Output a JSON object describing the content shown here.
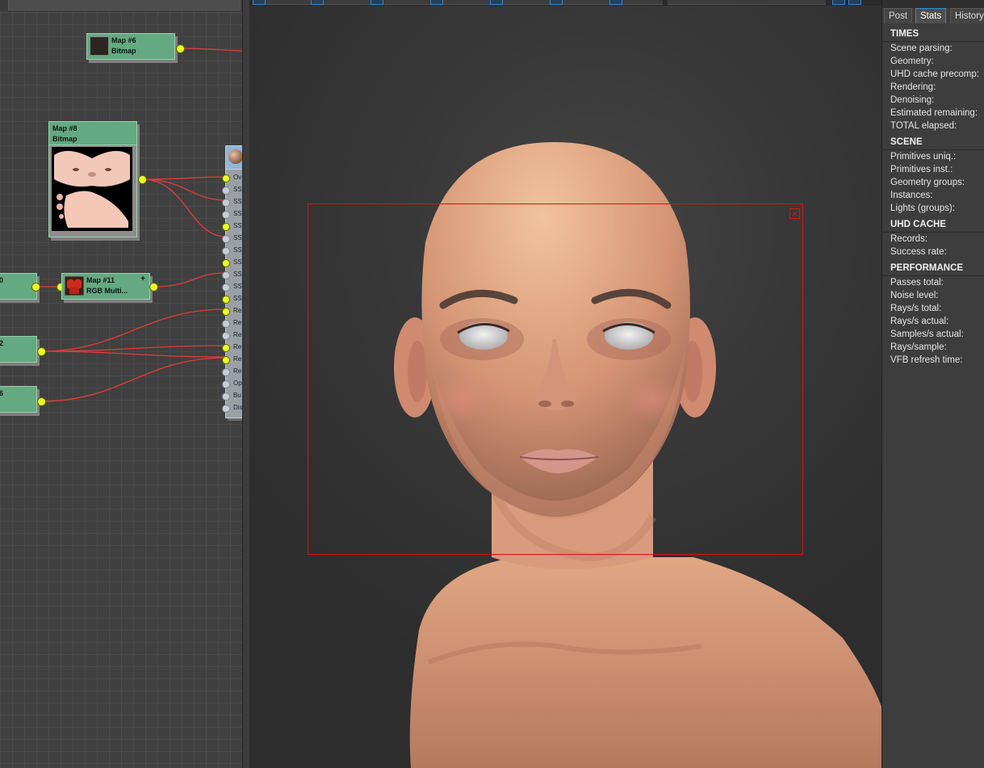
{
  "slate": {
    "nodes": {
      "map6": {
        "title": "Map #6",
        "type": "Bitmap"
      },
      "map8": {
        "title": "Map #8",
        "type": "Bitmap"
      },
      "map11": {
        "title": "Map #11",
        "type": "RGB  Multi...",
        "plus": "+"
      },
      "left_a": "0",
      "left_b": "2",
      "left_c": "6"
    },
    "material_slots": [
      "Ov",
      "SS",
      "SS",
      "SS",
      "SS",
      "SS",
      "SS",
      "SS",
      "SS",
      "SS",
      "SS",
      "Re",
      "Re",
      "Re",
      "Re",
      "Re",
      "Re",
      "Op",
      "Bu",
      "Dis"
    ]
  },
  "vfb": {
    "region_close": "×"
  },
  "panel": {
    "tabs": [
      "Post",
      "Stats",
      "History"
    ],
    "active_tab": "Stats",
    "sections": [
      {
        "head": "TIMES",
        "rows": [
          "Scene parsing:",
          "Geometry:",
          "UHD cache precomp:",
          "Rendering:",
          "Denoising:",
          "Estimated remaining:",
          "TOTAL elapsed:"
        ]
      },
      {
        "head": "SCENE",
        "rows": [
          "Primitives uniq.:",
          "Primitives inst.:",
          "Geometry groups:",
          "Instances:",
          "Lights (groups):"
        ]
      },
      {
        "head": "UHD CACHE",
        "rows": [
          "Records:",
          "Success rate:"
        ]
      },
      {
        "head": "PERFORMANCE",
        "rows": [
          "Passes total:",
          "Noise level:",
          "Rays/s total:",
          "Rays/s actual:",
          "Samples/s actual:",
          "Rays/sample:",
          "VFB refresh time:"
        ]
      }
    ]
  },
  "colors": {
    "node_green": "#64a981",
    "wire_red": "#e33b3b",
    "socket_yellow": "#eaff2a",
    "region_red": "#dd1111",
    "tab_accent": "#2f8fd6"
  }
}
